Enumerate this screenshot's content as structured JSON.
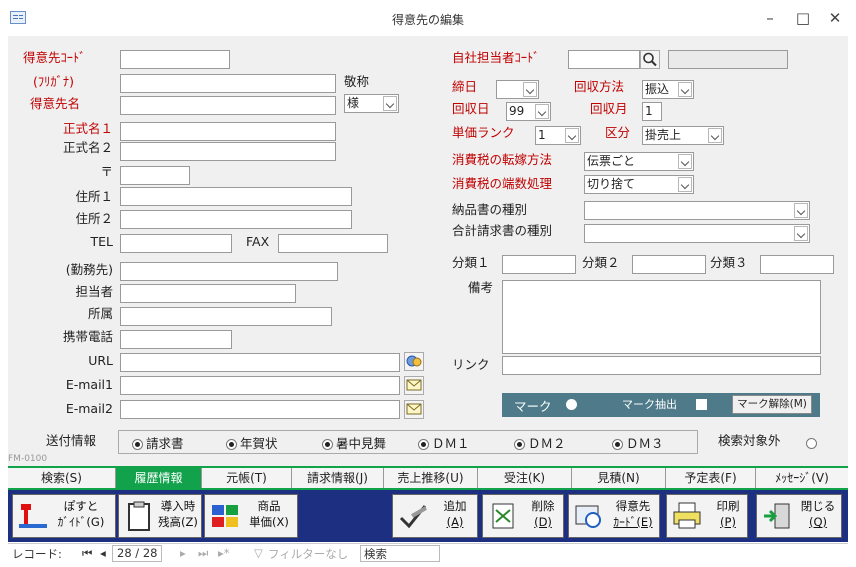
{
  "window": {
    "title": "得意先の編集",
    "minimize": "–",
    "maximize": "□",
    "close": "✕"
  },
  "left": {
    "code_label": "得意先ｺｰﾄﾞ",
    "kana_label": "(ﾌﾘｶﾞﾅ)",
    "name_label": "得意先名",
    "honorific_label": "敬称",
    "honorific_value": "様",
    "official1_label": "正式名１",
    "official2_label": "正式名２",
    "postal_label": "〒",
    "addr1_label": "住所１",
    "addr2_label": "住所２",
    "tel_label": "TEL",
    "fax_label": "FAX",
    "employer_label": "(勤務先)",
    "person_label": "担当者",
    "dept_label": "所属",
    "mobile_label": "携帯電話",
    "url_label": "URL",
    "email1_label": "E-mail1",
    "email2_label": "E-mail2"
  },
  "right": {
    "staff_label": "自社担当者ｺｰﾄﾞ",
    "closing_label": "締日",
    "collect_method_label": "回収方法",
    "collect_method_value": "振込",
    "collect_day_label": "回収日",
    "collect_day_value": "99",
    "collect_month_label": "回収月",
    "collect_month_value": "1",
    "price_rank_label": "単価ランク",
    "price_rank_value": "1",
    "category_label": "区分",
    "category_value": "掛売上",
    "tax_transfer_label": "消費税の転嫁方法",
    "tax_transfer_value": "伝票ごと",
    "tax_rounding_label": "消費税の端数処理",
    "tax_rounding_value": "切り捨て",
    "delivery_type_label": "納品書の種別",
    "invoice_type_label": "合計請求書の種別",
    "class1_label": "分類１",
    "class2_label": "分類２",
    "class3_label": "分類３",
    "remarks_label": "備考",
    "link_label": "リンク"
  },
  "markbar": {
    "mark_label": "マーク",
    "extract_label": "マーク抽出",
    "clear_button": "マーク解除(M)"
  },
  "send_info": {
    "label": "送付情報",
    "options": [
      "請求書",
      "年賀状",
      "暑中見舞",
      "ＤＭ１",
      "ＤＭ２",
      "ＤＭ３"
    ],
    "exclude_label": "検索対象外"
  },
  "form_id": "FM-0100",
  "tabs": [
    "検索(S)",
    "履歴情報",
    "元帳(T)",
    "請求情報(J)",
    "売上推移(U)",
    "受注(K)",
    "見積(N)",
    "予定表(F)",
    "ﾒｯｾｰｼﾞ(V)"
  ],
  "buttons": {
    "guide": [
      "ぽすと",
      "ｶﾞｲﾄﾞ(G)"
    ],
    "intro": [
      "導入時",
      "残高(Z)"
    ],
    "product": [
      "商品",
      "単価(X)"
    ],
    "add": [
      "追加",
      "(A)"
    ],
    "delete": [
      "削除",
      "(D)"
    ],
    "card": [
      "得意先",
      "ｶｰﾄﾞ(E)"
    ],
    "print": [
      "印刷",
      "(P)"
    ],
    "close": [
      "閉じる",
      "(Q)"
    ]
  },
  "nav": {
    "record_label": "レコード:",
    "first": "⏮",
    "prev": "◂",
    "current": "28 / 28",
    "next": "▸",
    "last": "⏭",
    "new": "▸*",
    "filter": "フィルターなし",
    "search": "検索"
  },
  "colors": {
    "tab_accent": "#12a24c",
    "button_bar": "#1c2f80",
    "mark_bar": "#4e7a89",
    "required_label": "#c00000"
  }
}
